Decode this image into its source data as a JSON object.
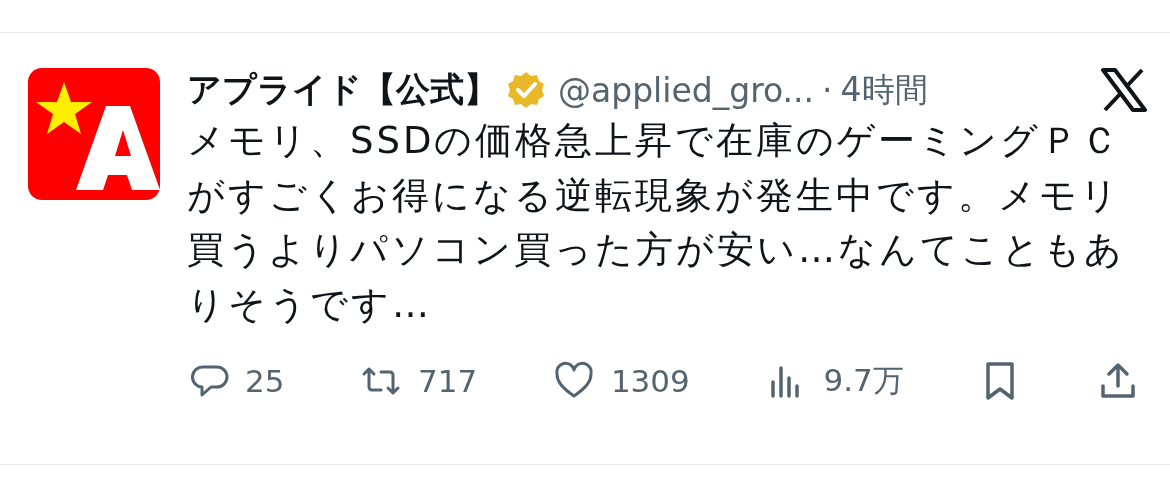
{
  "post": {
    "author": "アプライド【公式】",
    "verified": true,
    "handle": "@applied_gro...",
    "separator": "·",
    "time": "4時間",
    "body": "メモリ、SSDの価格急上昇で在庫のゲーミングＰＣがすごくお得になる逆転現象が発生中です。メモリ買うよりパソコン買った方が安い…なんてこともありそうです…",
    "actions": [
      {
        "kind": "reply",
        "count": "25"
      },
      {
        "kind": "repost",
        "count": "717"
      },
      {
        "kind": "like",
        "count": "1309"
      },
      {
        "kind": "views",
        "count": "9.7万"
      },
      {
        "kind": "bookmark"
      },
      {
        "kind": "share"
      }
    ]
  }
}
